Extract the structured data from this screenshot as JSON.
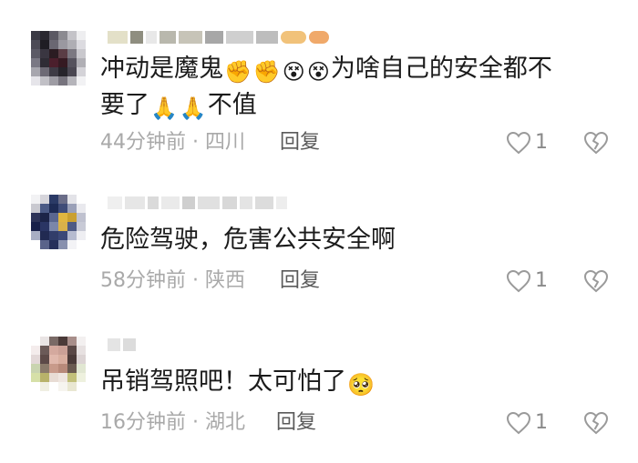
{
  "comments": [
    {
      "text_lines": [
        "冲动是魔鬼",
        "不值"
      ],
      "inline_1": "为啥自己的安全都不",
      "inline_2": "要了",
      "time": "44分钟前",
      "dot": "·",
      "location": "四川",
      "reply_label": "回复",
      "likes": "1",
      "emojis": [
        "✊",
        "✊",
        "😵",
        "😵",
        "🙏",
        "🙏"
      ]
    },
    {
      "text": "危险驾驶，危害公共安全啊",
      "time": "58分钟前",
      "dot": "·",
      "location": "陕西",
      "reply_label": "回复",
      "likes": "1"
    },
    {
      "text": "吊销驾照吧！太可怕了",
      "time": "16分钟前",
      "dot": "·",
      "location": "湖北",
      "reply_label": "回复",
      "likes": "1",
      "emojis": [
        "🥺"
      ]
    }
  ],
  "colors": {
    "meta": "#a9a9a9",
    "reply": "#5a5a5a",
    "icon": "#9a9a9a"
  },
  "icons": [
    "heart-icon",
    "broken-heart-icon"
  ]
}
